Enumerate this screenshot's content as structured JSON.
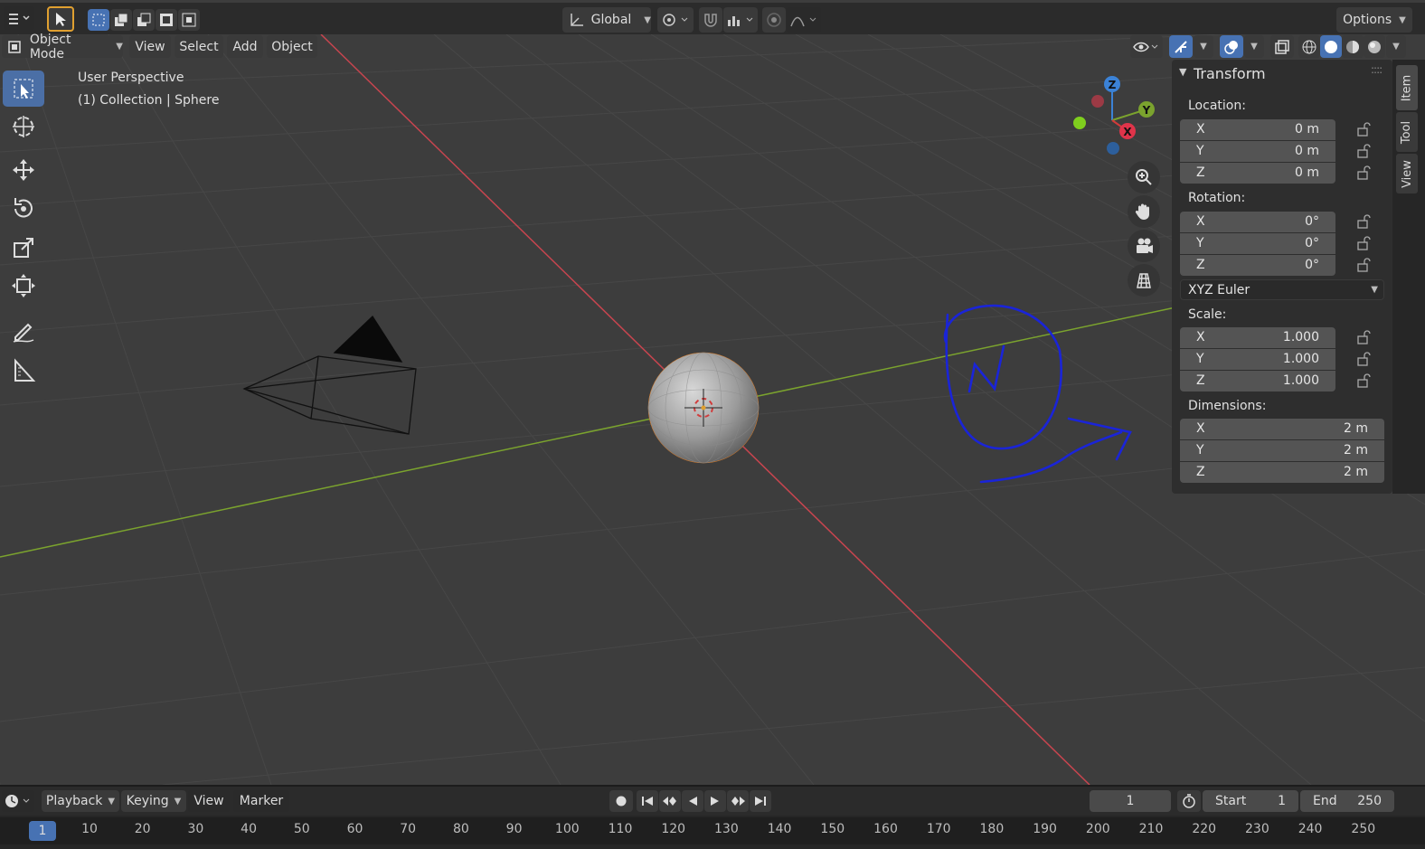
{
  "header": {
    "orientation": "Global",
    "options": "Options"
  },
  "menu": {
    "mode": "Object Mode",
    "items": [
      "View",
      "Select",
      "Add",
      "Object"
    ]
  },
  "viewport": {
    "perspective": "User Perspective",
    "collection": "(1) Collection | Sphere",
    "gizmo_axes": [
      "Z",
      "Y",
      "X"
    ]
  },
  "tools": [
    "select-box-icon",
    "cursor-icon",
    "move-icon",
    "rotate-icon",
    "scale-icon",
    "transform-icon",
    "annotate-icon",
    "measure-icon"
  ],
  "npanel": {
    "title": "Transform",
    "location_label": "Location:",
    "location": [
      {
        "axis": "X",
        "value": "0 m"
      },
      {
        "axis": "Y",
        "value": "0 m"
      },
      {
        "axis": "Z",
        "value": "0 m"
      }
    ],
    "rotation_label": "Rotation:",
    "rotation": [
      {
        "axis": "X",
        "value": "0°"
      },
      {
        "axis": "Y",
        "value": "0°"
      },
      {
        "axis": "Z",
        "value": "0°"
      }
    ],
    "rotation_mode": "XYZ Euler",
    "scale_label": "Scale:",
    "scale": [
      {
        "axis": "X",
        "value": "1.000"
      },
      {
        "axis": "Y",
        "value": "1.000"
      },
      {
        "axis": "Z",
        "value": "1.000"
      }
    ],
    "dimensions_label": "Dimensions:",
    "dimensions": [
      {
        "axis": "X",
        "value": "2 m"
      },
      {
        "axis": "Y",
        "value": "2 m"
      },
      {
        "axis": "Z",
        "value": "2 m"
      }
    ]
  },
  "side_tabs": [
    "Item",
    "Tool",
    "View"
  ],
  "timeline": {
    "menus": [
      "Playback",
      "Keying",
      "View",
      "Marker"
    ],
    "current_frame": "1",
    "start_label": "Start",
    "start": "1",
    "end_label": "End",
    "end": "250",
    "ruler_current": "1",
    "ruler_ticks": [
      "10",
      "20",
      "30",
      "40",
      "50",
      "60",
      "70",
      "80",
      "90",
      "100",
      "110",
      "120",
      "130",
      "140",
      "150",
      "160",
      "170",
      "180",
      "190",
      "200",
      "210",
      "220",
      "230",
      "240",
      "250"
    ]
  },
  "colors": {
    "accent": "#4772b3",
    "x_axis": "#c8454f",
    "y_axis": "#7ba32e",
    "z_axis": "#3b82d6",
    "annotation": "#1a24d8"
  }
}
